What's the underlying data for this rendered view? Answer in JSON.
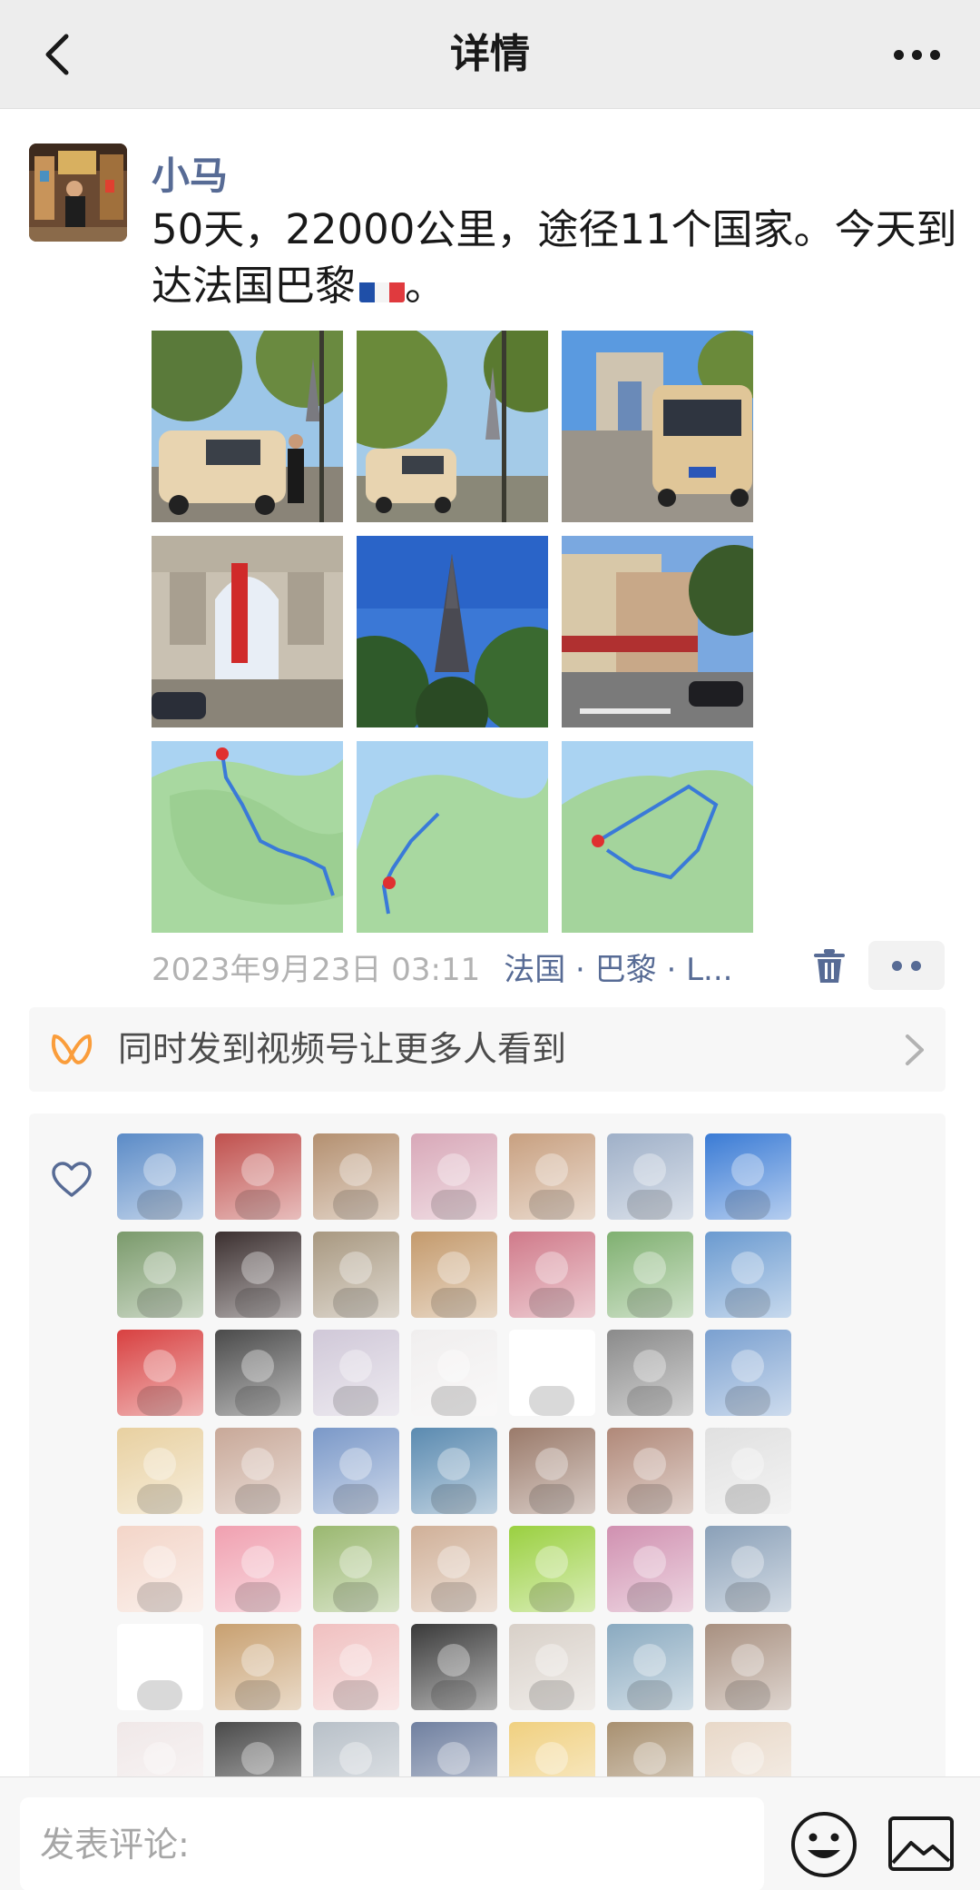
{
  "navbar": {
    "title": "详情",
    "back_icon": "chevron-left-icon",
    "more_icon": "more-dots-icon"
  },
  "post": {
    "author": "小马",
    "text": "50天，22000公里，途径11个国家。今天到达法国巴黎",
    "text_suffix": "。",
    "flag": "france-flag",
    "photos": [
      {
        "name": "photo-van-eiffel-1",
        "kind": "van-eiffel"
      },
      {
        "name": "photo-van-eiffel-2",
        "kind": "van-eiffel"
      },
      {
        "name": "photo-van-arc",
        "kind": "arc-van"
      },
      {
        "name": "photo-arc-de-triomphe",
        "kind": "arc"
      },
      {
        "name": "photo-eiffel-tower",
        "kind": "eiffel"
      },
      {
        "name": "photo-paris-street",
        "kind": "street"
      },
      {
        "name": "photo-map-russia",
        "kind": "map"
      },
      {
        "name": "photo-map-europe",
        "kind": "map"
      },
      {
        "name": "photo-map-france",
        "kind": "map"
      }
    ],
    "time": "2023年9月23日 03:11",
    "location": "法国 · 巴黎 · L..."
  },
  "promo": {
    "text": "同时发到视频号让更多人看到",
    "icon": "channels-icon"
  },
  "likes": {
    "icon": "heart-icon",
    "avatars": [
      "#5b8bc7",
      "#c0504d",
      "#b49070",
      "#d8a8b8",
      "#c8a080",
      "#9fb0c8",
      "#3a7bd5",
      "#7a9a6b",
      "#3b2f2f",
      "#a89880",
      "#c49a6c",
      "#d07a8a",
      "#7fb070",
      "#6a9ad0",
      "#d84040",
      "#4a4a4a",
      "#d0c8d8",
      "#f0eeee",
      "#ffffff",
      "#8a8a8a",
      "#7aa0d0",
      "#e8d0a0",
      "#c8a898",
      "#7a98c8",
      "#5a8ab0",
      "#9a7a6a",
      "#b08878",
      "#e0e0e0",
      "#f3d5c8",
      "#f0a0b0",
      "#9ab870",
      "#d0b098",
      "#9ad040",
      "#d090b0",
      "#8aa0b8",
      "#ffffff",
      "#c8a070",
      "#f0c0c0",
      "#3a3a3a",
      "#d8d0c8",
      "#8aaac0",
      "#a89080",
      "#f0e8e8",
      "#4a4a4a",
      "#b8c0c8",
      "#7080a0",
      "#f0d080",
      "#a89070",
      "#e8d8c8"
    ]
  },
  "comment": {
    "placeholder": "发表评论:",
    "emoji_icon": "emoji-icon",
    "image_icon": "image-icon"
  }
}
